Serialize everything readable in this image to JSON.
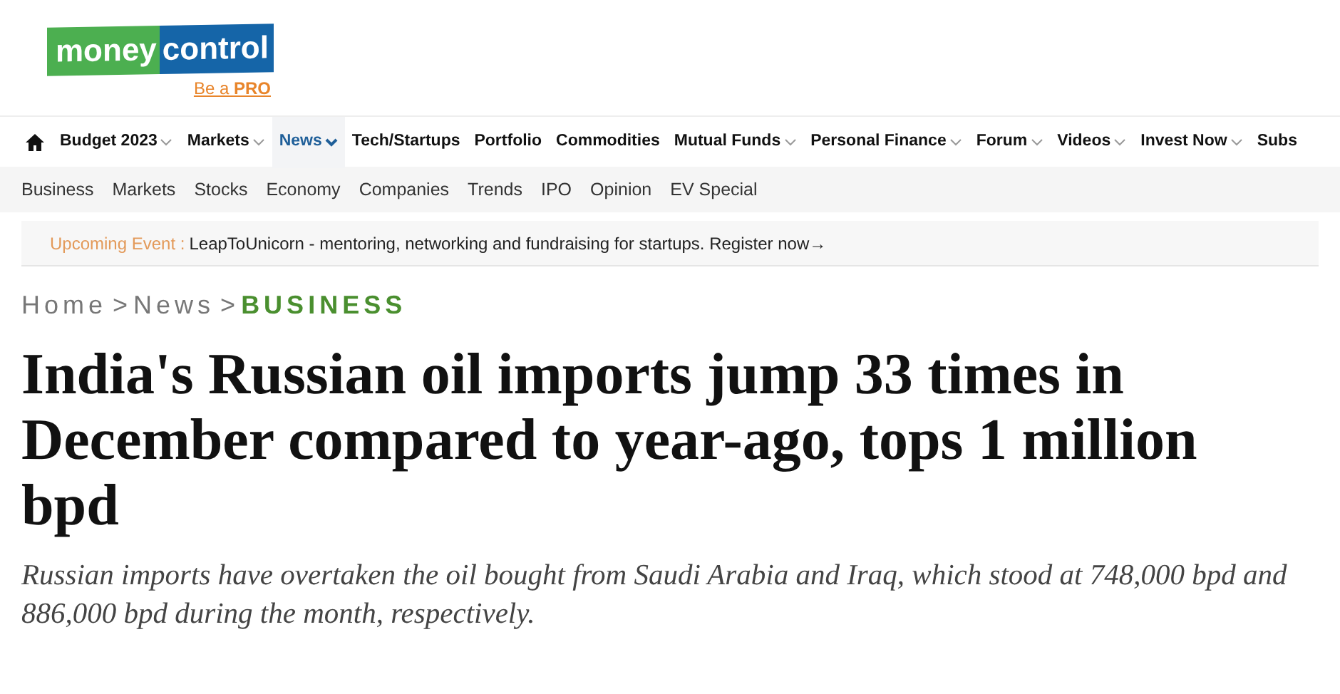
{
  "logo": {
    "left": "money",
    "right": "control",
    "tagline": "Be a **PRO**"
  },
  "main_nav": [
    {
      "label": "Budget 2023",
      "dropdown": true,
      "selected": false
    },
    {
      "label": "Markets",
      "dropdown": true,
      "selected": false
    },
    {
      "label": "News",
      "dropdown": true,
      "selected": true
    },
    {
      "label": "Tech/Startups",
      "dropdown": false,
      "selected": false
    },
    {
      "label": "Portfolio",
      "dropdown": false,
      "selected": false
    },
    {
      "label": "Commodities",
      "dropdown": false,
      "selected": false
    },
    {
      "label": "Mutual Funds",
      "dropdown": true,
      "selected": false
    },
    {
      "label": "Personal Finance",
      "dropdown": true,
      "selected": false
    },
    {
      "label": "Forum",
      "dropdown": true,
      "selected": false
    },
    {
      "label": "Videos",
      "dropdown": true,
      "selected": false
    },
    {
      "label": "Invest Now",
      "dropdown": true,
      "selected": false
    },
    {
      "label": "Subs",
      "dropdown": false,
      "selected": false
    }
  ],
  "sub_nav": [
    "Business",
    "Markets",
    "Stocks",
    "Economy",
    "Companies",
    "Trends",
    "IPO",
    "Opinion",
    "EV Special"
  ],
  "event_banner": {
    "label": "Upcoming Event :",
    "text": "LeapToUnicorn - mentoring, networking and fundraising for startups. Register now→"
  },
  "breadcrumb": [
    {
      "label": "Home",
      "current": false
    },
    {
      "label": ">",
      "kind": "sep"
    },
    {
      "label": "News",
      "current": false
    },
    {
      "label": ">",
      "kind": "sep"
    },
    {
      "label": "BUSINESS",
      "current": true
    }
  ],
  "headline": "India's Russian oil imports jump 33 times in December compared to year-ago, tops 1 million bpd",
  "summary": "Russian imports have overtaken the oil bought from Saudi Arabia and Iraq, which stood at 748,000 bpd and 886,000 bpd during the month, respectively."
}
